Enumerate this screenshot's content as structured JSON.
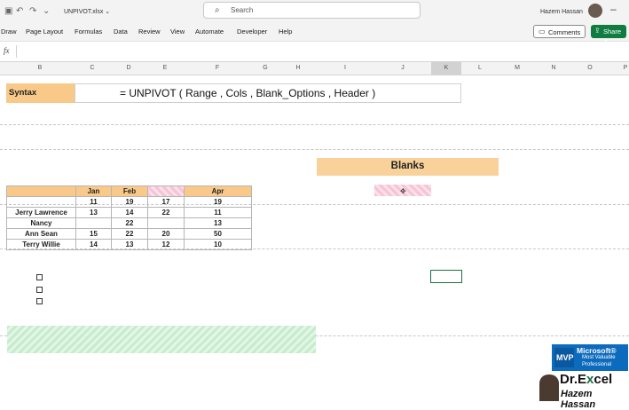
{
  "titlebar": {
    "filename": "UNPIVOT.xlsx ⌄",
    "search_placeholder": "Search",
    "user_name": "Hazem Hassan"
  },
  "ribbon": {
    "tabs": [
      "Draw",
      "Page Layout",
      "Formulas",
      "Data",
      "Review",
      "View",
      "Automate",
      "Developer",
      "Help"
    ],
    "comments": "Comments",
    "share": "Share ⌄"
  },
  "formula_bar": {
    "fx": "fx"
  },
  "columns": [
    "B",
    "C",
    "D",
    "E",
    "F",
    "G",
    "H",
    "I",
    "J",
    "K",
    "L",
    "M",
    "N",
    "O",
    "P"
  ],
  "syntax": {
    "label": "Syntax",
    "formula": "= UNPIVOT ( Range , Cols , Blank_Options , Header )"
  },
  "blanks": {
    "title": "Blanks"
  },
  "table": {
    "headers": [
      "",
      "Jan",
      "Feb",
      "",
      "Apr"
    ],
    "rows": [
      [
        "",
        "11",
        "19",
        "17",
        "19"
      ],
      [
        "Jerry Lawrence",
        "13",
        "14",
        "22",
        "11"
      ],
      [
        "Nancy",
        "",
        "22",
        "",
        "13"
      ],
      [
        "Ann Sean",
        "15",
        "22",
        "20",
        "50"
      ],
      [
        "Terry Willie",
        "14",
        "13",
        "12",
        "10"
      ]
    ]
  },
  "mvp": {
    "line1": "Microsoft®",
    "line2": "Most Valuable",
    "line3": "Professional",
    "logo": "MVP"
  },
  "brand": {
    "name_a": "Dr.E",
    "name_x": "x",
    "name_b": "cel",
    "author": "Hazem Hassan"
  }
}
